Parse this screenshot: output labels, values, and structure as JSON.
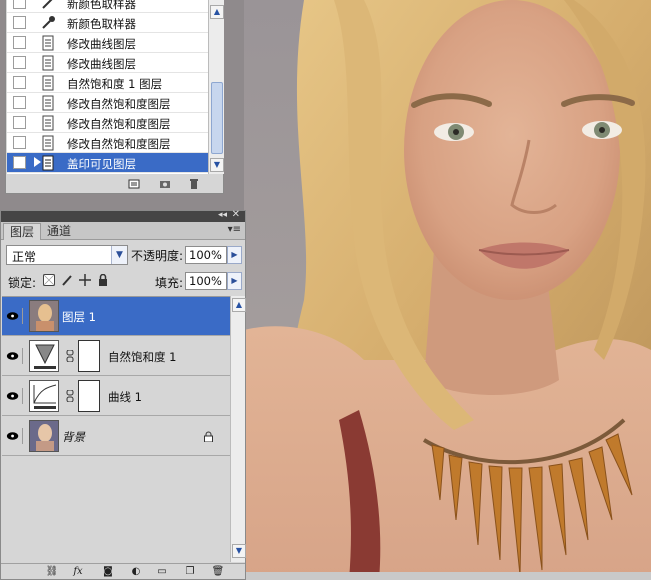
{
  "history": {
    "items": [
      {
        "label": "新颜色取样器",
        "partial": true
      },
      {
        "label": "新颜色取样器"
      },
      {
        "label": "修改曲线图层"
      },
      {
        "label": "修改曲线图层"
      },
      {
        "label": "自然饱和度 1 图层"
      },
      {
        "label": "修改自然饱和度图层"
      },
      {
        "label": "修改自然饱和度图层"
      },
      {
        "label": "修改自然饱和度图层"
      },
      {
        "label": "盖印可见图层",
        "selected": true
      }
    ]
  },
  "layers_panel": {
    "tabs": [
      "图层",
      "通道"
    ],
    "blend_mode": "正常",
    "opacity_label": "不透明度:",
    "opacity_value": "100%",
    "lock_label": "锁定:",
    "fill_label": "填充:",
    "fill_value": "100%",
    "layers": [
      {
        "name": "图层 1",
        "type": "pixel",
        "selected": true
      },
      {
        "name": "自然饱和度 1",
        "type": "vibrance",
        "mask": true
      },
      {
        "name": "曲线 1",
        "type": "curves",
        "mask": true
      },
      {
        "name": "背景",
        "type": "background",
        "locked": true
      }
    ],
    "footer_icons": [
      "link-icon",
      "fx-icon",
      "mask-icon",
      "adjustment-icon",
      "group-icon",
      "new-layer-icon",
      "trash-icon"
    ]
  },
  "colors": {
    "selection": "#3a6bc6",
    "panel": "#d6d6d6",
    "titlebar": "#454545"
  }
}
